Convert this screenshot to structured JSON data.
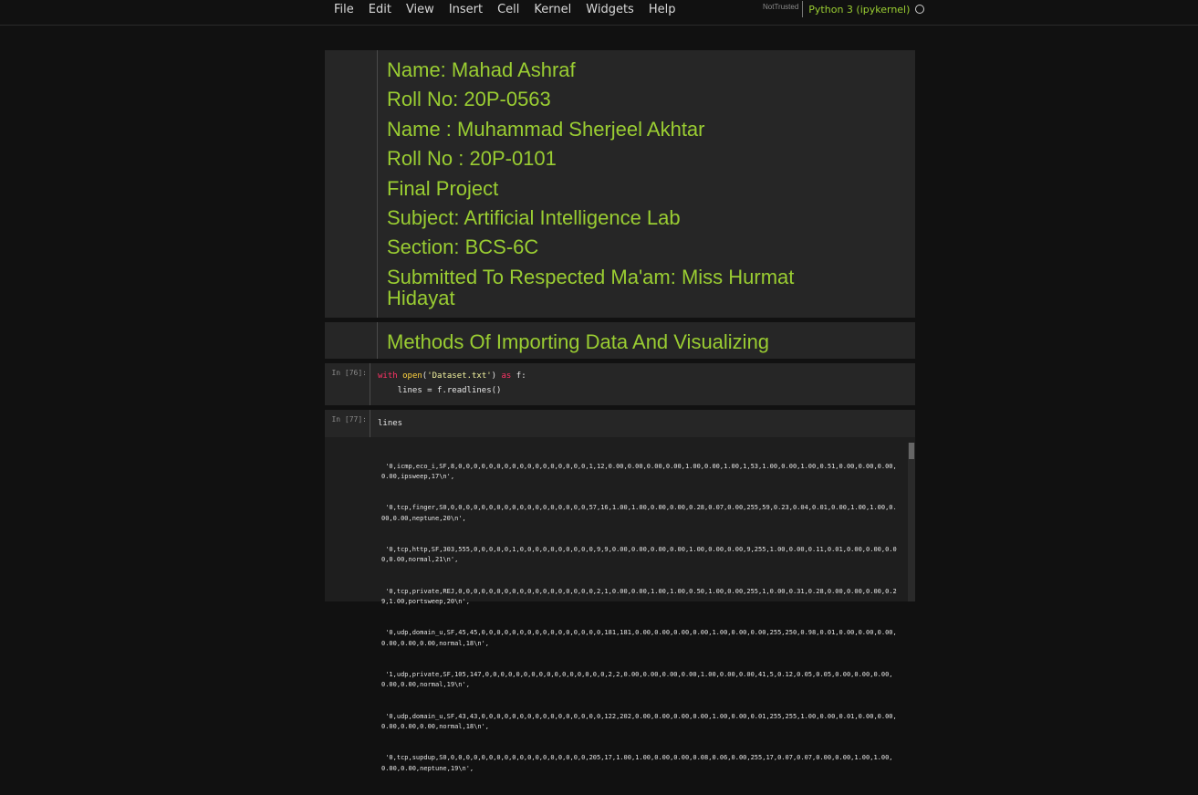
{
  "menu": [
    "File",
    "Edit",
    "View",
    "Insert",
    "Cell",
    "Kernel",
    "Widgets",
    "Help"
  ],
  "kernel": {
    "trust_label": "NotTrusted",
    "name": "Python 3 (ipykernel)"
  },
  "md_cell_1": {
    "lines": [
      "Name: Mahad Ashraf",
      "Roll No: 20P-0563",
      "Name : Muhammad Sherjeel Akhtar",
      "Roll No : 20P-0101",
      "Final Project",
      "Subject: Artificial Intelligence Lab",
      "Section: BCS-6C",
      "Submitted To Respected Ma'am: Miss Hurmat Hidayat"
    ]
  },
  "md_cell_2": {
    "heading": "Methods Of Importing Data And Visualizing"
  },
  "code_cell_1": {
    "prompt": "In [76]:",
    "line1": {
      "kw1": "with",
      "fn": "open",
      "str": "'Dataset.txt'",
      "kw2": "as",
      "rest": " f:"
    },
    "line2": "    lines = f.readlines()"
  },
  "code_cell_2": {
    "prompt": "In [77]:",
    "code": "lines",
    "output": [
      " '0,icmp,eco_i,SF,8,0,0,0,0,0,0,0,0,0,0,0,0,0,0,0,0,0,1,12,0.00,0.00,0.00,0.00,1.00,0.00,1.00,1,53,1.00,0.00,1.00,0.51,0.00,0.00,0.00,0.00,ipsweep,17\\n',",
      " '0,tcp,finger,S0,0,0,0,0,0,0,0,0,0,0,0,0,0,0,0,0,0,0,57,16,1.00,1.00,0.00,0.00,0.28,0.07,0.00,255,59,0.23,0.04,0.01,0.00,1.00,1.00,0.00,0.00,neptune,20\\n',",
      " '0,tcp,http,SF,303,555,0,0,0,0,0,1,0,0,0,0,0,0,0,0,0,0,9,9,0.00,0.00,0.00,0.00,1.00,0.00,0.00,9,255,1.00,0.00,0.11,0.01,0.00,0.00,0.00,0.00,normal,21\\n',",
      " '0,tcp,private,REJ,0,0,0,0,0,0,0,0,0,0,0,0,0,0,0,0,0,0,2,1,0.00,0.00,1.00,1.00,0.50,1.00,0.00,255,1,0.00,0.31,0.28,0.00,0.00,0.00,0.29,1.00,portsweep,20\\n',",
      " '0,udp,domain_u,SF,45,45,0,0,0,0,0,0,0,0,0,0,0,0,0,0,0,0,181,181,0.00,0.00,0.00,0.00,1.00,0.00,0.00,255,250,0.98,0.01,0.00,0.00,0.00,0.00,0.00,0.00,normal,18\\n',",
      " '1,udp,private,SF,105,147,0,0,0,0,0,0,0,0,0,0,0,0,0,0,0,0,2,2,0.00,0.00,0.00,0.00,1.00,0.00,0.00,41,5,0.12,0.05,0.05,0.00,0.00,0.00,0.00,0.00,normal,19\\n',",
      " '0,udp,domain_u,SF,43,43,0,0,0,0,0,0,0,0,0,0,0,0,0,0,0,0,122,202,0.00,0.00,0.00,0.00,1.00,0.00,0.01,255,255,1.00,0.00,0.01,0.00,0.00,0.00,0.00,0.00,normal,18\\n',",
      " '0,tcp,supdup,S0,0,0,0,0,0,0,0,0,0,0,0,0,0,0,0,0,0,0,205,17,1.00,1.00,0.00,0.00,0.08,0.06,0.00,255,17,0.07,0.07,0.00,0.00,1.00,1.00,0.00,0.00,neptune,19\\n',"
    ]
  },
  "colors": {
    "accent": "#9acd32",
    "background": "#111111",
    "cell": "#262626",
    "keyword": "#ff3366",
    "function": "#ffd23f"
  }
}
